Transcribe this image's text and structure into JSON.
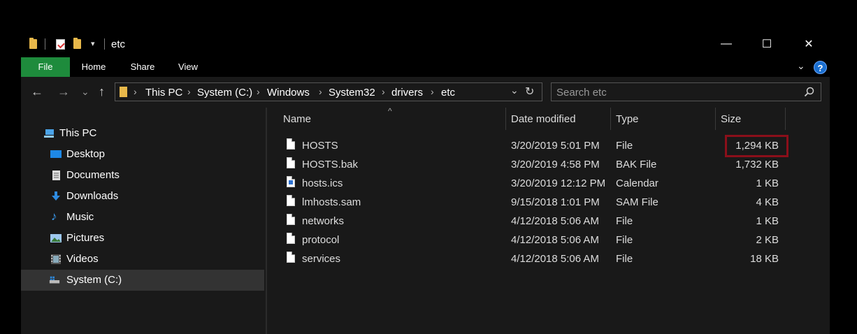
{
  "titlebar": {
    "title": "etc",
    "quick_access": [
      "folder-icon",
      "properties-icon",
      "new-folder-icon",
      "customize-dropdown-icon"
    ],
    "controls": {
      "minimize": "—",
      "maximize": "☐",
      "close": "✕"
    }
  },
  "ribbon": {
    "tabs": [
      "File",
      "Home",
      "Share",
      "View"
    ],
    "accent": "#1e8b3c",
    "help": "?"
  },
  "navbar": {
    "back": "←",
    "forward": "→",
    "recent": "⌄",
    "up": "↑",
    "breadcrumb": [
      "This PC",
      "System (C:)",
      "Windows",
      "System32",
      "drivers",
      "etc"
    ],
    "search_placeholder": "Search etc"
  },
  "sidebar": {
    "items": [
      {
        "label": "This PC",
        "icon": "computer-icon"
      },
      {
        "label": "Desktop",
        "icon": "desktop-icon"
      },
      {
        "label": "Documents",
        "icon": "documents-icon"
      },
      {
        "label": "Downloads",
        "icon": "downloads-icon"
      },
      {
        "label": "Music",
        "icon": "music-icon"
      },
      {
        "label": "Pictures",
        "icon": "pictures-icon"
      },
      {
        "label": "Videos",
        "icon": "videos-icon"
      },
      {
        "label": "System (C:)",
        "icon": "drive-icon",
        "selected": true
      }
    ]
  },
  "filelist": {
    "columns": {
      "name": "Name",
      "date": "Date modified",
      "type": "Type",
      "size": "Size"
    },
    "sort_indicator": "^",
    "rows": [
      {
        "name": "HOSTS",
        "date": "3/20/2019 5:01 PM",
        "type": "File",
        "size": "1,294 KB",
        "icon": "file-icon"
      },
      {
        "name": "HOSTS.bak",
        "date": "3/20/2019 4:58 PM",
        "type": "BAK File",
        "size": "1,732 KB",
        "icon": "file-icon"
      },
      {
        "name": "hosts.ics",
        "date": "3/20/2019 12:12 PM",
        "type": "Calendar",
        "size": "1 KB",
        "icon": "calendar-file-icon"
      },
      {
        "name": "lmhosts.sam",
        "date": "9/15/2018 1:01 PM",
        "type": "SAM File",
        "size": "4 KB",
        "icon": "file-icon"
      },
      {
        "name": "networks",
        "date": "4/12/2018 5:06 AM",
        "type": "File",
        "size": "1 KB",
        "icon": "file-icon"
      },
      {
        "name": "protocol",
        "date": "4/12/2018 5:06 AM",
        "type": "File",
        "size": "2 KB",
        "icon": "file-icon"
      },
      {
        "name": "services",
        "date": "4/12/2018 5:06 AM",
        "type": "File",
        "size": "18 KB",
        "icon": "file-icon"
      }
    ]
  },
  "highlight_color": "#8b0f1a"
}
